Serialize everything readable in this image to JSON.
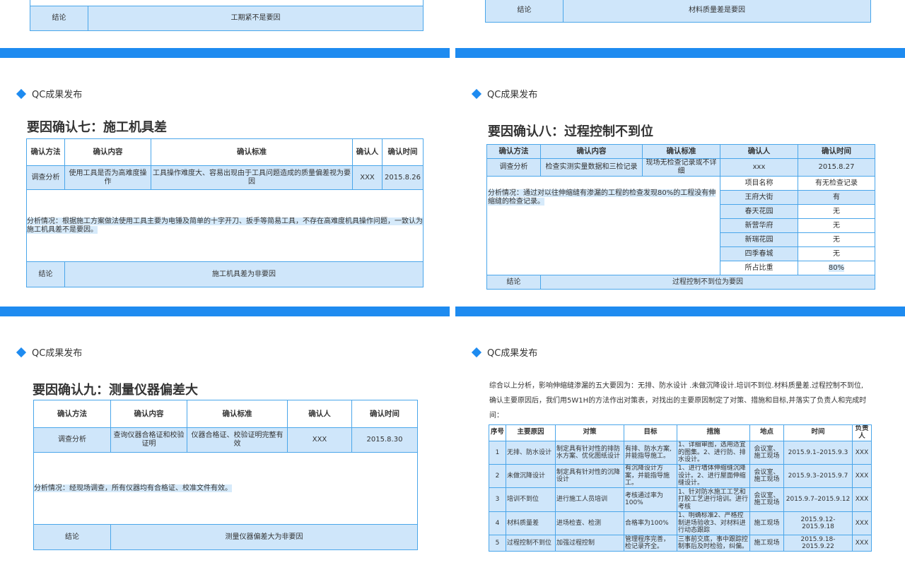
{
  "common": {
    "header": "QC成果发布"
  },
  "top_left": {
    "conclusion_label": "结论",
    "conclusion_value": "工期紧不是要因"
  },
  "top_right": {
    "conclusion_label": "结论",
    "conclusion_value": "材料质量差是要因"
  },
  "slide7": {
    "title": "要因确认七：施工机具差",
    "headers": [
      "确认方法",
      "确认内容",
      "确认标准",
      "确认人",
      "确认时间"
    ],
    "row": [
      "调查分析",
      "使用工具是否为高难度操作",
      "工具操作难度大、容易出现由于工具问题造成的质量偏差视为要因",
      "XXX",
      "2015.8.26"
    ],
    "analysis": "分析情况：根据施工方案做法使用工具主要为电锤及简单的十字开刀、扳手等简易工具，不存在高难度机具操作问题，一致认为施工机具差不是要因。",
    "conclusion_label": "结论",
    "conclusion_value": "施工机具差为非要因"
  },
  "slide8": {
    "title": "要因确认八：过程控制不到位",
    "headers": [
      "确认方法",
      "确认内容",
      "确认标准",
      "确认人",
      "确认时间"
    ],
    "row": [
      "调查分析",
      "检查实测实量数据和三检记录",
      "现场无检查记录或不详细",
      "xxx",
      "2015.8.27"
    ],
    "analysis": "分析情况：通过对以往伸缩缝有渗漏的工程的检查发现80%的工程没有伸缩缝的检查记录。",
    "sub_headers": [
      "项目名称",
      "有无检查记录"
    ],
    "sub_rows": [
      [
        "王府大街",
        "有"
      ],
      [
        "春天花园",
        "无"
      ],
      [
        "新营华府",
        "无"
      ],
      [
        "新瑞花园",
        "无"
      ],
      [
        "四季春城",
        "无"
      ],
      [
        "所占比重",
        "80%"
      ]
    ],
    "conclusion_label": "结论",
    "conclusion_value": "过程控制不到位为要因"
  },
  "slide9": {
    "title": "要因确认九：测量仪器偏差大",
    "headers": [
      "确认方法",
      "确认内容",
      "确认标准",
      "确认人",
      "确认时间"
    ],
    "row": [
      "调查分析",
      "查询仪器合格证和校验证明",
      "仪器合格证、校验证明完整有效",
      "XXX",
      "2015.8.30"
    ],
    "analysis": "分析情况：经现场调查，所有仪器均有合格证、校准文件有效。",
    "conclusion_label": "结论",
    "conclusion_value": "测量仪器偏差大为非要因"
  },
  "slide10": {
    "summary": "综合以上分析，影响伸缩缝渗漏的五大要因为：无排、防水设计 .未做沉降设计.培训不到位.材料质量差.过程控制不到位, 确认主要原因后，我们用5W1H的方法作出对策表，对找出的主要原因制定了对策、措施和目标,并落实了负责人和完成时间：",
    "headers": [
      "序号",
      "主要原因",
      "对策",
      "目标",
      "措施",
      "地点",
      "时间",
      "负责人"
    ],
    "rows": [
      [
        "1",
        "无排、防水设计",
        "制定具有针对性的排防水方案、优化图纸设计",
        "有排、防水方案,并能指导施工。",
        "1、详细审图，选用适宜的图集。2、进行防、排水设计。",
        "会议室、施工现场",
        "2015.9.1–2015.9.3",
        "XXX"
      ],
      [
        "2",
        "未做沉降设计",
        "制定具有针对性的沉降设计",
        "有沉降设计方案，并能指导施工。",
        "1、进行墙体伸缩缝沉降设计。2、进行屋面伸缩缝设计。",
        "会议室、施工现场",
        "2015.9.3–2015.9.7",
        "XXX"
      ],
      [
        "3",
        "培训不到位",
        "进行施工人员培训",
        "考核通过率为100%",
        "1、针对防水施工工艺和打胶工艺进行培训。进行考核",
        "会议室、施工现场",
        "2015.9.7–2015.9.12",
        "XXX"
      ],
      [
        "4",
        "材料质量差",
        "进场检查、检测",
        "合格率为100%",
        "1、明确标准2、严格控制进场验收3、对材料进行动态跟踪",
        "施工现场",
        "2015.9.12-2015.9.18",
        "XXX"
      ],
      [
        "5",
        "过程控制不到位",
        "加强过程控制",
        "管理程序完善，检记录齐全。",
        "三事前交底，事中跟踪控制事后及时检验，纠偏。",
        "施工现场",
        "2015.9.18-2015.9.22",
        "XXX"
      ]
    ]
  }
}
